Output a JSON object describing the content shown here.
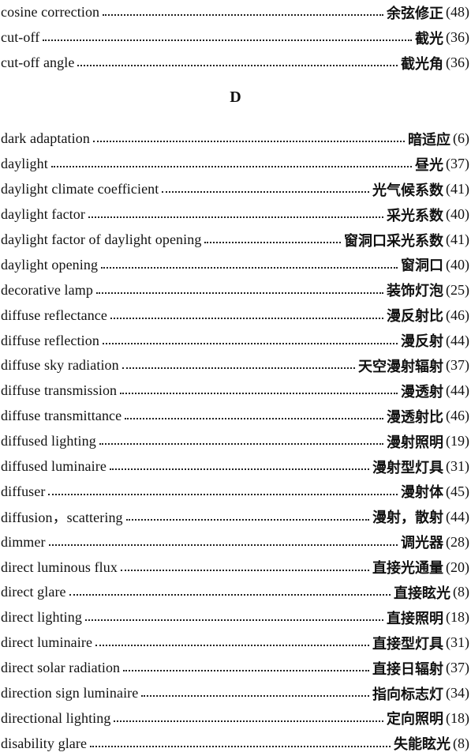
{
  "section_letter": "D",
  "top_entries": [
    {
      "en": "cosine correction",
      "cn": "余弦修正",
      "page": "(48)"
    },
    {
      "en": "cut-off",
      "cn": "截光",
      "page": "(36)"
    },
    {
      "en": "cut-off angle",
      "cn": "截光角",
      "page": "(36)"
    }
  ],
  "entries": [
    {
      "en": "dark adaptation",
      "cn": "暗适应",
      "page": "(6)"
    },
    {
      "en": "daylight",
      "cn": "昼光",
      "page": "(37)"
    },
    {
      "en": "daylight climate coefficient",
      "cn": "光气候系数",
      "page": "(41)"
    },
    {
      "en": "daylight factor",
      "cn": "采光系数",
      "page": "(40)"
    },
    {
      "en": "daylight factor of daylight opening",
      "cn": "窗洞口采光系数",
      "page": "(41)"
    },
    {
      "en": "daylight opening",
      "cn": "窗洞口",
      "page": "(40)"
    },
    {
      "en": "decorative lamp",
      "cn": "装饰灯泡",
      "page": "(25)"
    },
    {
      "en": "diffuse reflectance",
      "cn": "漫反射比",
      "page": "(46)"
    },
    {
      "en": "diffuse reflection",
      "cn": "漫反射",
      "page": "(44)"
    },
    {
      "en": "diffuse sky radiation",
      "cn": "天空漫射辐射",
      "page": "(37)"
    },
    {
      "en": "diffuse transmission",
      "cn": "漫透射",
      "page": "(44)"
    },
    {
      "en": "diffuse transmittance",
      "cn": "漫透射比",
      "page": "(46)"
    },
    {
      "en": "diffused lighting",
      "cn": "漫射照明",
      "page": "(19)"
    },
    {
      "en": "diffused luminaire",
      "cn": "漫射型灯具",
      "page": "(31)"
    },
    {
      "en": "diffuser",
      "cn": "漫射体",
      "page": "(45)"
    },
    {
      "en": "diffusion，scattering",
      "cn": "漫射，散射",
      "page": "(44)"
    },
    {
      "en": "dimmer",
      "cn": "调光器",
      "page": "(28)"
    },
    {
      "en": "direct luminous flux",
      "cn": "直接光通量",
      "page": "(20)"
    },
    {
      "en": "direct glare",
      "cn": "直接眩光",
      "page": "(8)"
    },
    {
      "en": "direct lighting",
      "cn": "直接照明",
      "page": "(18)"
    },
    {
      "en": "direct luminaire",
      "cn": "直接型灯具",
      "page": "(31)"
    },
    {
      "en": "direct solar radiation",
      "cn": "直接日辐射",
      "page": "(37)"
    },
    {
      "en": "direction sign luminaire",
      "cn": "指向标志灯",
      "page": "(34)"
    },
    {
      "en": "directional lighting",
      "cn": "定向照明",
      "page": "(18)"
    },
    {
      "en": "disability glare",
      "cn": "失能眩光",
      "page": "(8)"
    }
  ]
}
